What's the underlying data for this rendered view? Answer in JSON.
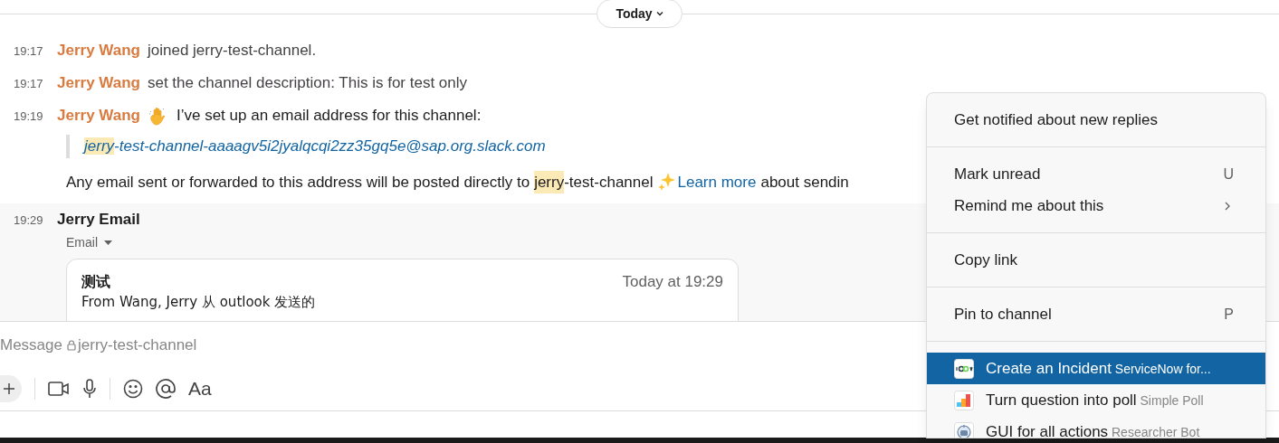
{
  "date_divider": {
    "label": "Today"
  },
  "messages": [
    {
      "kind": "system",
      "time": "19:17",
      "author": "Jerry Wang",
      "text": "joined jerry-test-channel."
    },
    {
      "kind": "system",
      "time": "19:17",
      "author": "Jerry Wang",
      "text": "set the channel description: This is for test only"
    },
    {
      "kind": "email_setup",
      "time": "19:19",
      "author": "Jerry Wang",
      "text": "I’ve set up an email address for this channel:",
      "address": [
        {
          "text": "jerry",
          "highlight": true
        },
        {
          "text": "-test-channel-aaaagv5i2jyalqcqi2zz35gq5e@sap.org.slack.com",
          "highlight": false
        }
      ],
      "note": [
        {
          "kind": "text",
          "text": "Any email sent or forwarded to this address will be posted directly to"
        },
        {
          "kind": "highlight",
          "text": "jerry"
        },
        {
          "kind": "text",
          "text": "-test-channel"
        },
        {
          "kind": "sparkles"
        },
        {
          "kind": "link",
          "text": "Learn more"
        },
        {
          "kind": "text",
          "text": "about sendin"
        }
      ]
    },
    {
      "kind": "email",
      "time": "19:29",
      "author": "Jerry Email",
      "hovered": true,
      "label": "Email",
      "card": {
        "subject": "测试",
        "timestamp": "Today at 19:29",
        "body": "From Wang, Jerry 从 outlook 发送的"
      }
    }
  ],
  "composer": {
    "placeholder": "Message",
    "channel": "jerry-test-channel",
    "format_label": "Aa"
  },
  "context_menu": {
    "sections": [
      [
        {
          "label": "Get notified about new replies",
          "selected": false
        }
      ],
      [
        {
          "label": "Mark unread",
          "shortcut": "U",
          "selected": false
        },
        {
          "label": "Remind me about this",
          "submenu": true,
          "selected": false
        }
      ],
      [
        {
          "label": "Copy link",
          "selected": false
        }
      ],
      [
        {
          "label": "Pin to channel",
          "shortcut": "P",
          "selected": false
        }
      ],
      [
        {
          "label": "Create an Incident",
          "app": "ServiceNow for...",
          "selected": true
        },
        {
          "label": "Turn question into poll",
          "app": "Simple Poll",
          "selected": false
        },
        {
          "label": "GUI for all actions",
          "app": "Researcher Bot",
          "selected": false
        }
      ]
    ]
  }
}
